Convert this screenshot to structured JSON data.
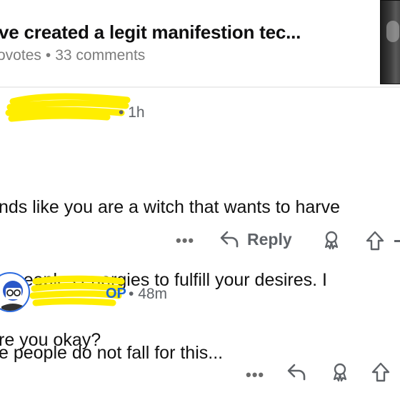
{
  "post": {
    "title": "ve created a legit manifestion tec...",
    "votes": "ovotes",
    "separator": "•",
    "comments": "33 comments"
  },
  "comment1": {
    "time_sep": "•",
    "time": "1h",
    "body_lines": [
      "nds like you are a witch that wants to harve",
      "e peoples energies to fulfill your desires. I",
      "e people do not fall for this..."
    ],
    "actions": {
      "more": "•••",
      "reply": "Reply"
    }
  },
  "comment2": {
    "op_badge": "OP",
    "time_sep": "•",
    "time": "48m",
    "body": "re you okay?",
    "actions": {
      "more": "•••"
    }
  },
  "colors": {
    "scribble": "#ffee00",
    "op": "#1f66d1",
    "meta": "#7c7c7c",
    "icon": "#5f6368"
  },
  "icons": [
    "reply-arrow-icon",
    "award-icon",
    "upvote-arrow-icon",
    "more-icon",
    "avatar"
  ]
}
